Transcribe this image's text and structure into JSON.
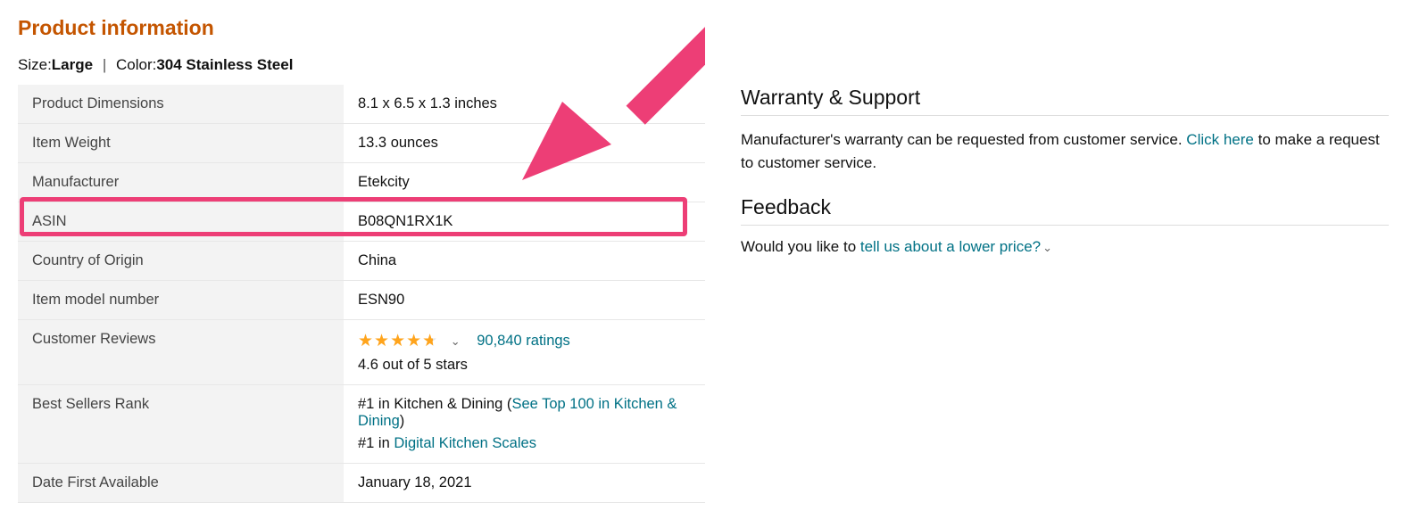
{
  "heading": "Product information",
  "variant": {
    "size_label": "Size:",
    "size_value": "Large",
    "sep": "|",
    "color_label": "Color:",
    "color_value": "304 Stainless Steel"
  },
  "specs": {
    "product_dimensions": {
      "label": "Product Dimensions",
      "value": "8.1 x 6.5 x 1.3 inches"
    },
    "item_weight": {
      "label": "Item Weight",
      "value": "13.3 ounces"
    },
    "manufacturer": {
      "label": "Manufacturer",
      "value": "Etekcity"
    },
    "asin": {
      "label": "ASIN",
      "value": "B08QN1RX1K"
    },
    "country_of_origin": {
      "label": "Country of Origin",
      "value": "China"
    },
    "item_model_number": {
      "label": "Item model number",
      "value": "ESN90"
    },
    "customer_reviews": {
      "label": "Customer Reviews",
      "ratings_link": "90,840 ratings",
      "summary": "4.6 out of 5 stars"
    },
    "best_sellers_rank": {
      "label": "Best Sellers Rank",
      "line1_prefix": "#1 in Kitchen & Dining (",
      "line1_link": "See Top 100 in Kitchen & Dining",
      "line1_suffix": ")",
      "line2_prefix": "#1 in ",
      "line2_link": "Digital Kitchen Scales"
    },
    "date_first_available": {
      "label": "Date First Available",
      "value": "January 18, 2021"
    }
  },
  "right": {
    "warranty_heading": "Warranty & Support",
    "warranty_text_prefix": "Manufacturer's warranty can be requested from customer service. ",
    "warranty_link": "Click here",
    "warranty_text_suffix": " to make a request to customer service.",
    "feedback_heading": "Feedback",
    "feedback_prompt_prefix": "Would you like to ",
    "feedback_link": "tell us about a lower price?"
  }
}
